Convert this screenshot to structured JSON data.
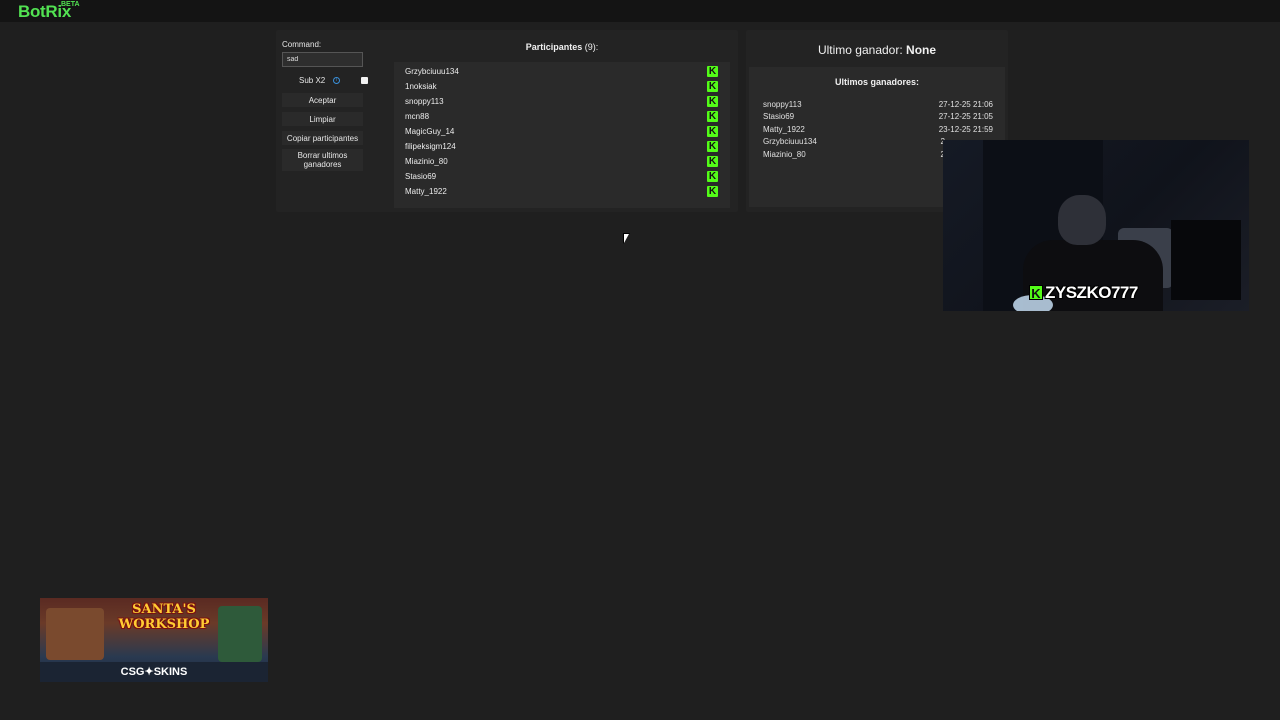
{
  "app": {
    "name": "BotRix",
    "badge": "BETA"
  },
  "command": {
    "label": "Command:",
    "value": "sad"
  },
  "sub_option": {
    "label": "Sub X2",
    "info_icon": "info-icon",
    "checked": false
  },
  "buttons": {
    "accept": "Aceptar",
    "clear": "Limpiar",
    "copy_participants": "Copiar participantes",
    "delete_last_winners": "Borrar ultimos ganadores"
  },
  "participants": {
    "title": "Participantes",
    "count_text": "(9):",
    "platform_icon": "kick-icon",
    "items": [
      "Grzybciuuu134",
      "1noksiak",
      "snoppy113",
      "mcn88",
      "MagicGuy_14",
      "filipeksigm124",
      "Miazinio_80",
      "Stasio69",
      "Matty_1922"
    ]
  },
  "last_winner": {
    "label": "Ultimo ganador:",
    "value": "None"
  },
  "recent_winners": {
    "title": "Ultimos ganadores:",
    "items": [
      {
        "name": "snoppy113",
        "date": "27-12-25 21:06"
      },
      {
        "name": "Stasio69",
        "date": "27-12-25 21:05"
      },
      {
        "name": "Matty_1922",
        "date": "23-12-25 21:59"
      },
      {
        "name": "Grzybciuuu134",
        "date": "2"
      },
      {
        "name": "Miazinio_80",
        "date": "2"
      }
    ]
  },
  "webcam": {
    "streamer_name": "ZYSZKO777",
    "k_badge": "K"
  },
  "sponsor": {
    "title_line1": "SANTA'S",
    "title_line2": "WORKSHOP",
    "brand": "CSG✦SKINS"
  },
  "colors": {
    "background": "#1f1f1f",
    "panel": "#232323",
    "list_bg": "#2a2a2a",
    "brand_green": "#52e252",
    "kick_green": "#53fc18",
    "info_blue": "#3a8fd8"
  }
}
